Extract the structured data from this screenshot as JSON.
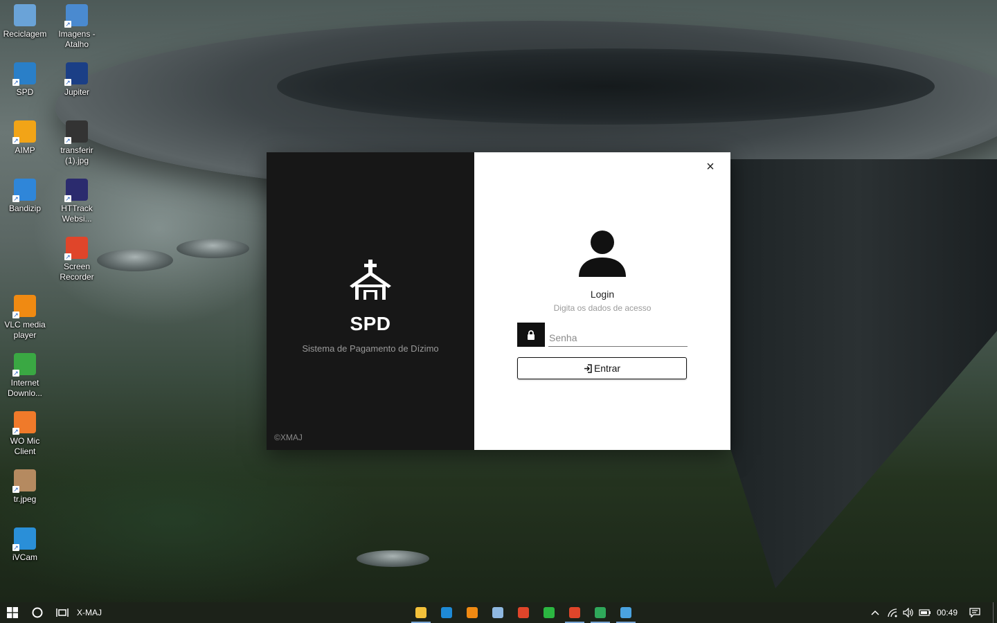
{
  "desktop": {
    "icons": [
      {
        "label": "Reciclagem",
        "icon": "recycle-bin-icon",
        "color": "#6aa3d8"
      },
      {
        "label": "Imagens - Atalho",
        "icon": "image-icon",
        "color": "#4a8ad0"
      },
      {
        "label": "SPD",
        "icon": "spd-app-icon",
        "color": "#2a7fc8"
      },
      {
        "label": "Jupiter",
        "icon": "jupiter-icon",
        "color": "#1b3f86"
      },
      {
        "label": "AIMP",
        "icon": "aimp-icon",
        "color": "#f2a417"
      },
      {
        "label": "transferir (1).jpg",
        "icon": "image-file-icon",
        "color": "#333333"
      },
      {
        "label": "Bandizip",
        "icon": "bandizip-icon",
        "color": "#2f86d9"
      },
      {
        "label": "HTTrack Websi...",
        "icon": "httrack-icon",
        "color": "#2b2b6e"
      },
      {
        "label": "Screen Recorder",
        "icon": "screen-recorder-icon",
        "color": "#e0452a"
      },
      {
        "label": "VLC media player",
        "icon": "vlc-icon",
        "color": "#f08a12"
      },
      {
        "label": "Internet Downlo...",
        "icon": "internet-download-manager-icon",
        "color": "#3aa843"
      },
      {
        "label": "WO Mic Client",
        "icon": "microphone-icon",
        "color": "#f07a2a"
      },
      {
        "label": "tr.jpeg",
        "icon": "image-file-icon",
        "color": "#b58a60"
      },
      {
        "label": "iVCam",
        "icon": "ivcam-icon",
        "color": "#2a8fd8"
      }
    ]
  },
  "dialog": {
    "brand": {
      "title": "SPD",
      "subtitle": "Sistema de Pagamento de Dízimo",
      "copyright": "©XMAJ",
      "icon": "church-icon"
    },
    "form": {
      "close_label": "×",
      "title": "Login",
      "subtitle": "Digita os dados de acesso",
      "password_placeholder": "Senha",
      "password_value": "",
      "submit_label": "Entrar",
      "submit_icon": "sign-in-icon",
      "avatar_icon": "user-icon",
      "lock_icon": "lock-icon"
    }
  },
  "taskbar": {
    "search_label": "X-MAJ",
    "start_icon": "windows-start-icon",
    "cortana_icon": "cortana-circle-icon",
    "task_view_icon": "task-view-icon",
    "apps": [
      {
        "name": "file-explorer-icon",
        "color": "#f3c13a",
        "active": true
      },
      {
        "name": "vscode-icon",
        "color": "#1e8ad6",
        "active": false
      },
      {
        "name": "vlc-icon",
        "color": "#f08a12",
        "active": false
      },
      {
        "name": "notepad-icon",
        "color": "#8fb8e0",
        "active": false
      },
      {
        "name": "chrome-icon",
        "color": "#e0452a",
        "active": false
      },
      {
        "name": "whatsapp-icon",
        "color": "#2bb741",
        "active": false
      },
      {
        "name": "chrome-icon",
        "color": "#e0452a",
        "active": true
      },
      {
        "name": "git-icon",
        "color": "#2fa85a",
        "active": true
      },
      {
        "name": "spd-app-icon",
        "color": "#4aa3e0",
        "active": true
      }
    ],
    "tray": {
      "time": "00:49",
      "chevron_icon": "chevron-up-icon",
      "network_icon": "wifi-icon",
      "volume_icon": "speaker-icon",
      "battery_icon": "battery-icon",
      "notifications_icon": "notification-icon"
    }
  },
  "colors": {
    "brand_panel": "#171717",
    "form_panel": "#ffffff",
    "taskbar": "#1c2219"
  }
}
